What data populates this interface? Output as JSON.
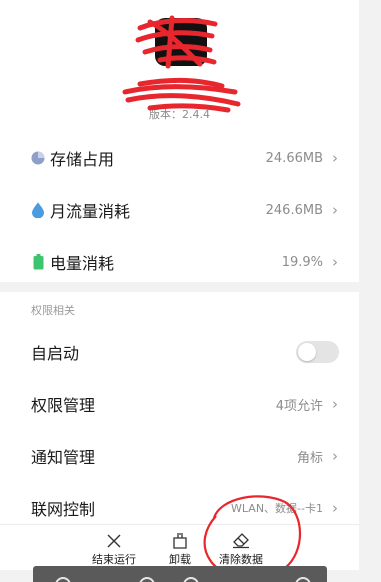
{
  "app": {
    "version": "版本：2.4.4"
  },
  "usage": [
    {
      "icon": "pie-chart-icon",
      "label": "存储占用",
      "value": "24.66MB"
    },
    {
      "icon": "water-drop-icon",
      "label": "月流量消耗",
      "value": "246.6MB"
    },
    {
      "icon": "battery-icon",
      "label": "电量消耗",
      "value": "19.9%"
    }
  ],
  "permissions": {
    "section_title": "权限相关",
    "autostart_label": "自启动",
    "autostart_enabled": false,
    "items": [
      {
        "label": "权限管理",
        "value": "4项允许"
      },
      {
        "label": "通知管理",
        "value": "角标"
      },
      {
        "label": "联网控制",
        "value": "WLAN、数据--卡1"
      }
    ]
  },
  "actions": [
    {
      "icon": "close-icon",
      "label": "结束运行"
    },
    {
      "icon": "uninstall-icon",
      "label": "卸载"
    },
    {
      "icon": "eraser-icon",
      "label": "清除数据"
    }
  ],
  "colors": {
    "storage_icon": "#8f9fc7",
    "traffic_icon": "#4a9be0",
    "battery_icon": "#3cc46e",
    "annotation_red": "#e8262d"
  }
}
